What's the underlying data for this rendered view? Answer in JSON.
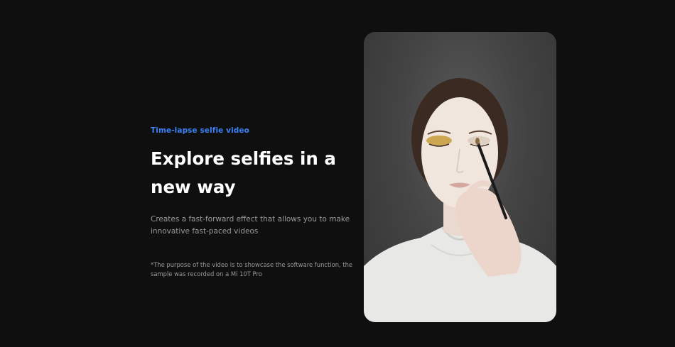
{
  "feature": {
    "eyebrow": "Time-lapse selfie video",
    "headline": "Explore selfies in a new way",
    "description": "Creates a fast-forward effect that allows you to make innovative fast-paced videos",
    "disclaimer": "*The purpose of the video is to showcase the software function, the sample was recorded on a Mi 10T Pro"
  },
  "colors": {
    "background": "#0f0f0f",
    "accent": "#3b82f6",
    "headline": "#ffffff",
    "body_text": "#9a9a9a"
  },
  "media": {
    "subject": "selfie-video-makeup-application"
  }
}
